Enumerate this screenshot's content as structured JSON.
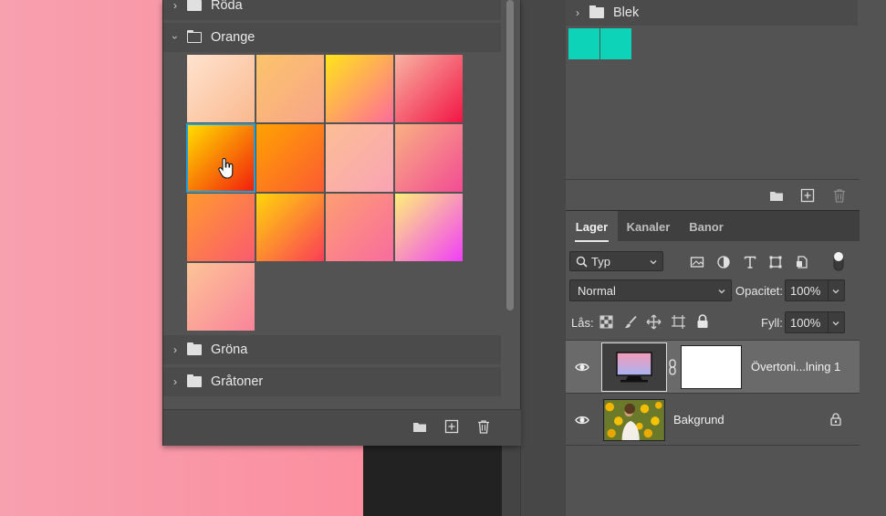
{
  "gradients_panel": {
    "groups_top": [
      {
        "label": "Röda",
        "expanded": false
      },
      {
        "label": "Orange",
        "expanded": true
      }
    ],
    "groups_bottom": [
      {
        "label": "Gröna",
        "expanded": false
      },
      {
        "label": "Gråtoner",
        "expanded": false
      }
    ],
    "swatches": [
      {
        "from": "#ffe3cf",
        "to": "#f9b98e"
      },
      {
        "from": "#fcc46b",
        "to": "#f7a58a"
      },
      {
        "from": "#ffe51a",
        "to": "#ff6b9a"
      },
      {
        "from": "#f8b3a3",
        "to": "#f21545"
      },
      {
        "from": "#ffe000",
        "to": "#f21c0c"
      },
      {
        "from": "#ffa300",
        "to": "#fb5b33"
      },
      {
        "from": "#fcbe95",
        "to": "#f9a4b4"
      },
      {
        "from": "#f9b083",
        "to": "#f24c94"
      },
      {
        "from": "#ff9a2e",
        "to": "#fa5b6f"
      },
      {
        "from": "#ffd60a",
        "to": "#fb3d57"
      },
      {
        "from": "#fd9e72",
        "to": "#f86c9e"
      },
      {
        "from": "#fff07a",
        "to": "#f13ef7"
      },
      {
        "from": "#fdc497",
        "to": "#f9849a"
      }
    ],
    "selected_swatch_index": 4,
    "footer_icons": [
      "new-group-icon",
      "new-preset-icon",
      "trash-icon"
    ]
  },
  "swatches_panel": {
    "group": {
      "label": "Blek",
      "expanded": false
    },
    "colors": [
      "#0dd3b8",
      "#0dd3b8"
    ]
  },
  "layers_panel": {
    "tabs": [
      {
        "label": "Lager",
        "active": true
      },
      {
        "label": "Kanaler",
        "active": false
      },
      {
        "label": "Banor",
        "active": false
      }
    ],
    "filter_label": "Typ",
    "blend_mode": "Normal",
    "opacity_label": "Opacitet:",
    "opacity_value": "100%",
    "lock_label": "Lås:",
    "fill_label": "Fyll:",
    "fill_value": "100%",
    "layers": [
      {
        "name": "Övertoni...lning 1",
        "selected": true
      },
      {
        "name": "Bakgrund",
        "selected": false,
        "locked": true
      }
    ]
  }
}
